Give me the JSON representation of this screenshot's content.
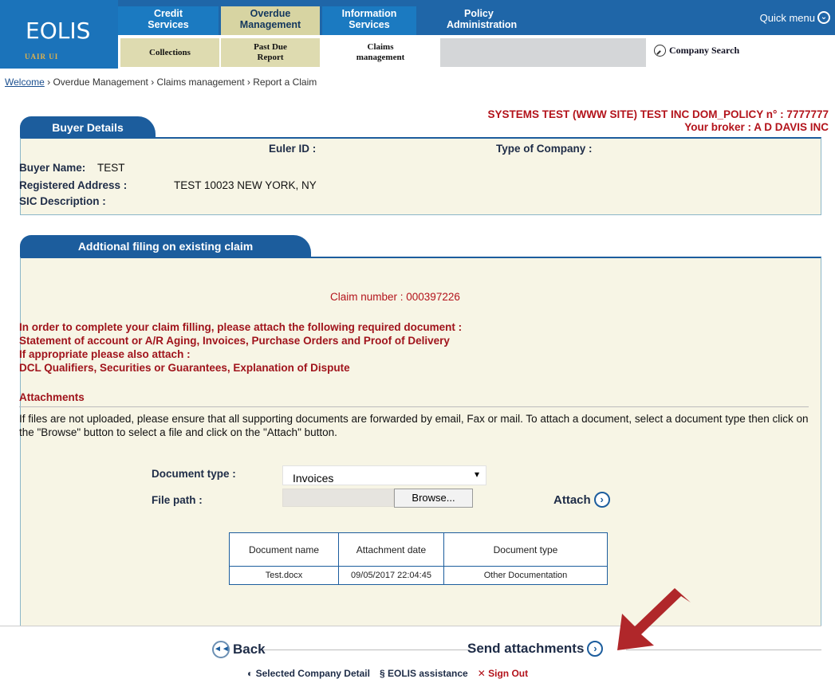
{
  "header": {
    "logo_text": "EOLIS",
    "logo_tag": "UAIR UI",
    "nav": [
      {
        "label_line1": "Credit",
        "label_line2": "Services"
      },
      {
        "label_line1": "Overdue",
        "label_line2": "Management"
      },
      {
        "label_line1": "Information",
        "label_line2": "Services"
      },
      {
        "label_line1": "Policy",
        "label_line2": "Administration"
      }
    ],
    "quick_menu": "Quick menu",
    "sub_nav": [
      {
        "label_line1": "Collections",
        "label_line2": ""
      },
      {
        "label_line1": "Past Due",
        "label_line2": "Report"
      },
      {
        "label_line1": "Claims",
        "label_line2": "management"
      }
    ],
    "company_search": "Company Search"
  },
  "breadcrumb": {
    "welcome": "Welcome",
    "rest": " › Overdue Management › Claims management › Report a Claim"
  },
  "policy": {
    "line1": "SYSTEMS TEST (WWW SITE) TEST INC DOM_POLICY n° : 7777777",
    "line2": "Your broker : A D DAVIS INC"
  },
  "buyer": {
    "tab": "Buyer Details",
    "euler_id_label": "Euler ID :",
    "type_label": "Type of Company :",
    "name_label": "Buyer Name:",
    "name_value": "TEST",
    "address_label": "Registered Address :",
    "address_value": "TEST 10023 NEW YORK, NY",
    "sic_label": "SIC Description :"
  },
  "claim": {
    "tab": "Addtional filing on existing claim",
    "claim_number": "Claim number  : 000397226",
    "instructions": [
      "In order to complete your claim filling, please attach the following required document :",
      "Statement of account or A/R Aging, Invoices, Purchase Orders and Proof of Delivery",
      "If appropriate please also attach :",
      "DCL Qualifiers, Securities or Guarantees, Explanation of Dispute"
    ],
    "attachments_heading": "Attachments",
    "attachments_help": "If files are not uploaded, please ensure that all supporting documents are forwarded by email, Fax or mail. To attach a document, select a document type then click on the \"Browse\" button to select a file and click on the \"Attach\" button.",
    "doc_type_label": "Document type :",
    "doc_type_value": "Invoices",
    "file_path_label": "File path :",
    "browse_label": "Browse...",
    "attach_label": "Attach",
    "table": {
      "headers": [
        "Document name",
        "Attachment date",
        "Document type"
      ],
      "rows": [
        [
          "Test.docx",
          "09/05/2017 22:04:45",
          "Other Documentation"
        ]
      ]
    }
  },
  "actions": {
    "back": "Back",
    "send": "Send  attachments"
  },
  "footer": {
    "selected": "Selected  Company  Detail",
    "assistance": "EOLIS  assistance",
    "signout": "Sign  Out"
  },
  "colors": {
    "brand_blue": "#1c5d9d",
    "alert_red": "#b3131b",
    "panel_bg": "#f7f5e5",
    "arrow": "#b0272a"
  }
}
